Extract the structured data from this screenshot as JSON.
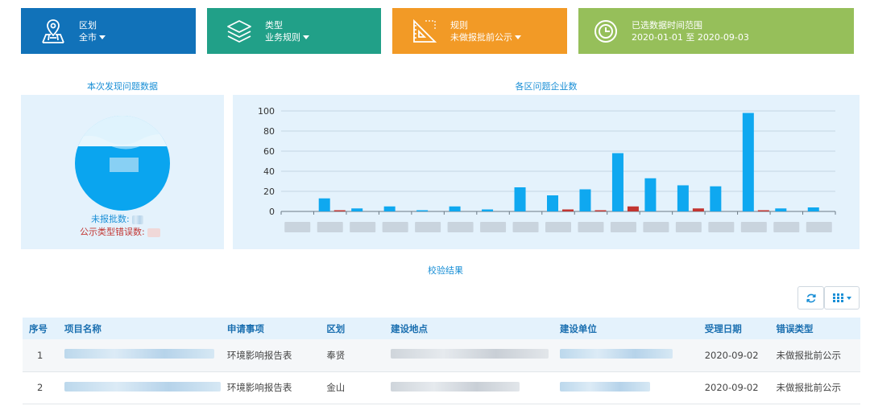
{
  "cards": [
    {
      "title": "区划",
      "value": "全市",
      "color": "#1172b9",
      "icon": "map-pin-icon",
      "dropdown": true
    },
    {
      "title": "类型",
      "value": "业务规则",
      "color": "#21a088",
      "icon": "layers-icon",
      "dropdown": true
    },
    {
      "title": "规则",
      "value": "未做报批前公示",
      "color": "#f29a26",
      "icon": "ruler-triangle-icon",
      "dropdown": true
    },
    {
      "title": "已选数据时间范围",
      "value": "2020-01-01 至 2020-09-03",
      "color": "#96bf5a",
      "icon": "clock-icon",
      "dropdown": false
    }
  ],
  "summary": {
    "title": "本次发现问题数据",
    "unreported_label": "未报批数:",
    "type_error_label": "公示类型错误数:"
  },
  "chart_title": "各区问题企业数",
  "chart_data": {
    "type": "bar",
    "title": "各区问题企业数",
    "categories": [
      "",
      "",
      "",
      "",
      "",
      "",
      "",
      "",
      "",
      "",
      "",
      "",
      "",
      "",
      "",
      "",
      ""
    ],
    "series": [
      {
        "values": [
          0,
          13,
          3,
          5,
          1,
          5,
          2,
          24,
          16,
          22,
          58,
          33,
          26,
          25,
          98,
          3,
          4
        ],
        "color": "#0fa8f0"
      },
      {
        "values": [
          0,
          1,
          0,
          0,
          0,
          0,
          0,
          0,
          2,
          1,
          5,
          0,
          3,
          0,
          1,
          0,
          0
        ],
        "color": "#c23531"
      }
    ],
    "ylim": [
      0,
      100
    ],
    "yticks": [
      0,
      20,
      40,
      60,
      80,
      100
    ],
    "grid": true
  },
  "results_title": "校验结果",
  "toolbar": {
    "refresh_icon": "refresh-icon",
    "columns_icon": "columns-grid-icon"
  },
  "table": {
    "headers": [
      "序号",
      "项目名称",
      "申请事项",
      "区划",
      "建设地点",
      "建设单位",
      "受理日期",
      "错误类型"
    ],
    "rows": [
      {
        "index": "1",
        "item": "环境影响报告表",
        "district": "奉贤",
        "date": "2020-09-02",
        "error": "未做报批前公示"
      },
      {
        "index": "2",
        "item": "环境影响报告表",
        "district": "金山",
        "date": "2020-09-02",
        "error": "未做报批前公示"
      }
    ]
  }
}
